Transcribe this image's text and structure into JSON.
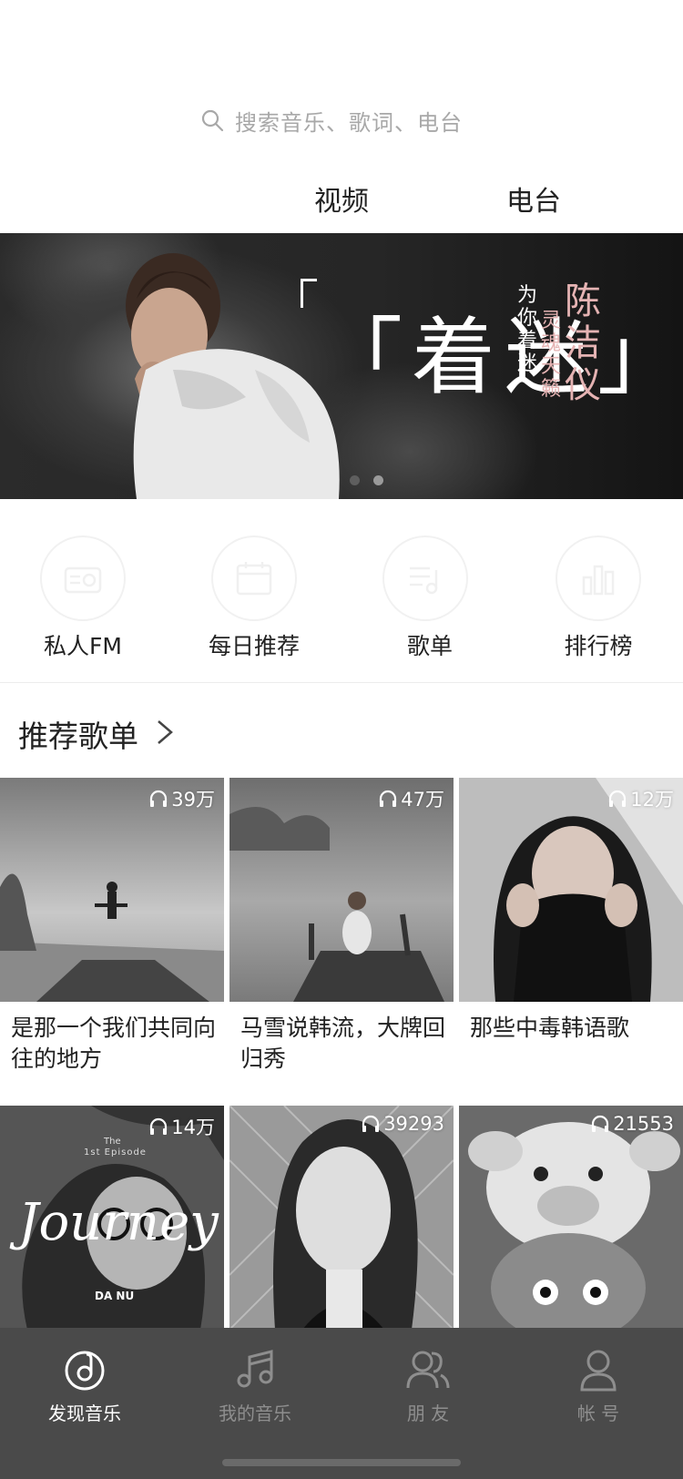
{
  "search": {
    "placeholder": "搜索音乐、歌词、电台"
  },
  "top_tabs": [
    {
      "label": "视频"
    },
    {
      "label": "电台"
    }
  ],
  "banner": {
    "title": "「着迷」",
    "subtitle_col1": "为你着迷",
    "subtitle_col2": "灵魂天籁",
    "artist": "陈洁仪",
    "page_count": 2
  },
  "quick_entries": [
    {
      "label": "私人FM",
      "icon": "radio-icon"
    },
    {
      "label": "每日推荐",
      "icon": "calendar-icon"
    },
    {
      "label": "歌单",
      "icon": "playlist-icon"
    },
    {
      "label": "排行榜",
      "icon": "chart-icon"
    }
  ],
  "recommended": {
    "title": "推荐歌单",
    "playlists": [
      {
        "title": "是那一个我们共同向往的地方",
        "play_count": "39万"
      },
      {
        "title": "马雪说韩流，大牌回归秀",
        "play_count": "47万"
      },
      {
        "title": "那些中毒韩语歌",
        "play_count": "12万"
      },
      {
        "title": "",
        "play_count": "14万",
        "cover_text": {
          "small1": "The",
          "small2": "1st Episode",
          "script": "Journey",
          "artist": "DA NU"
        }
      },
      {
        "title": "",
        "play_count": "39293"
      },
      {
        "title": "",
        "play_count": "21553"
      }
    ]
  },
  "tabbar": {
    "items": [
      {
        "label": "发现音乐",
        "icon": "music-note-circle-icon",
        "active": true
      },
      {
        "label": "我的音乐",
        "icon": "music-notes-icon",
        "active": false
      },
      {
        "label": "朋 友",
        "icon": "friends-icon",
        "active": false
      },
      {
        "label": "帐 号",
        "icon": "account-icon",
        "active": false
      }
    ]
  },
  "colors": {
    "tabbar_bg": "#4a4a4a",
    "tab_active": "#ffffff",
    "tab_inactive": "#8e8e8e",
    "banner_accent": "#e5b3b3"
  }
}
